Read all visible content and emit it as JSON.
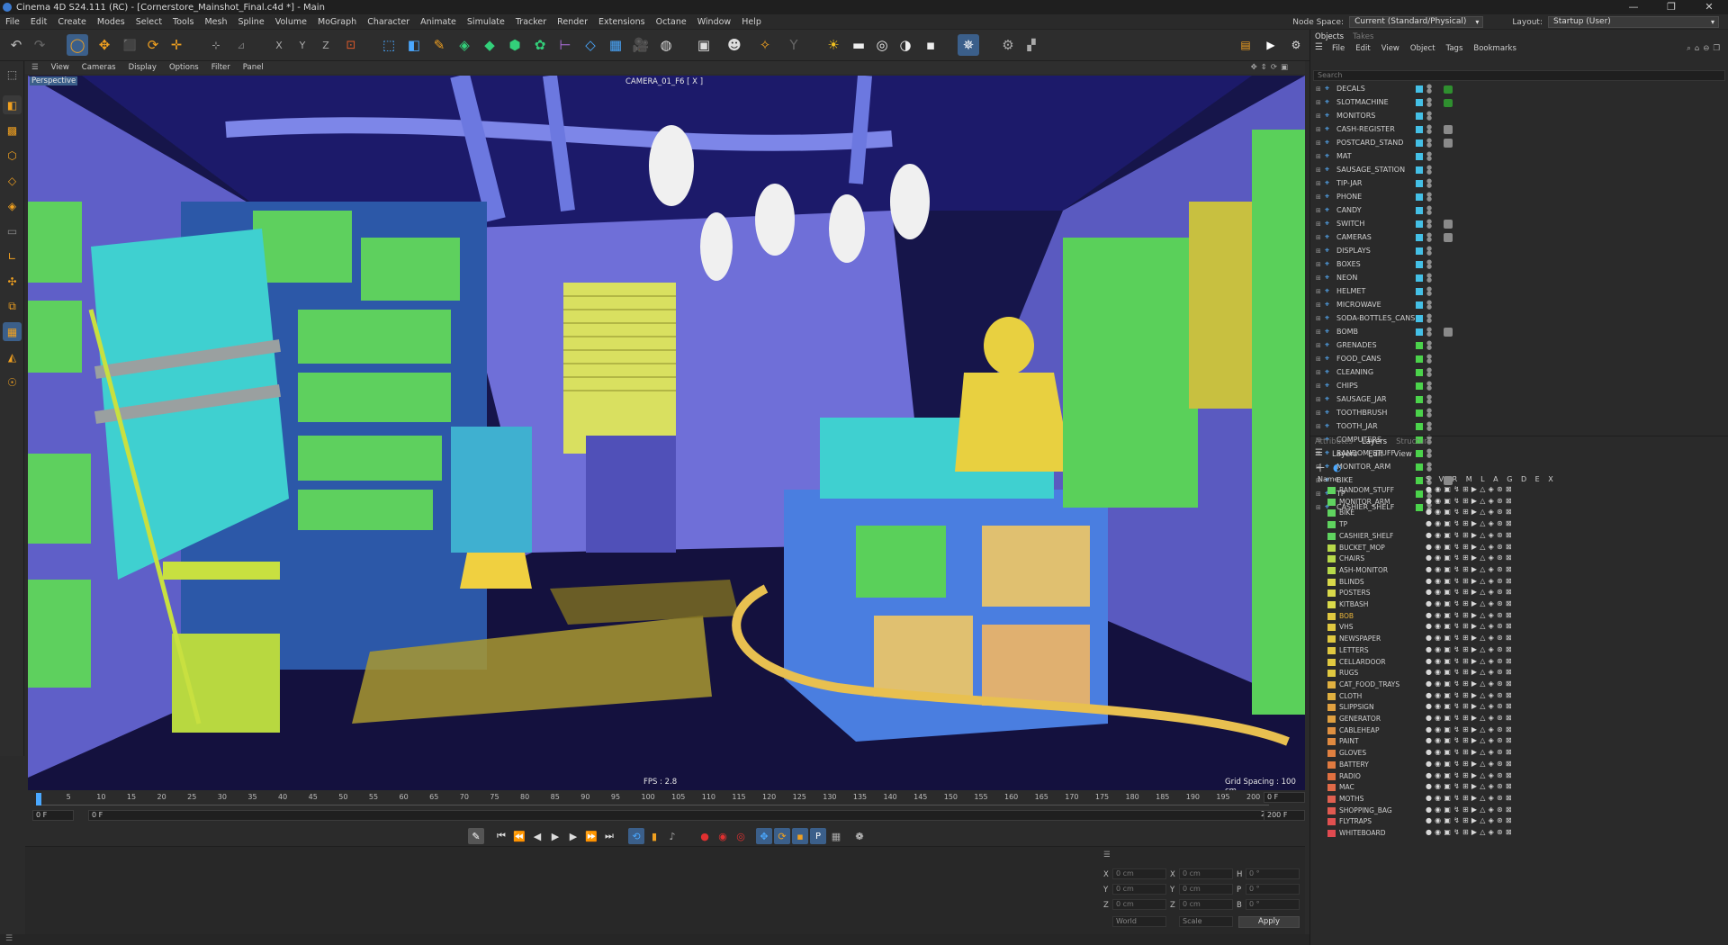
{
  "titlebar": {
    "title": "Cinema 4D S24.111 (RC) - [Cornerstore_Mainshot_Final.c4d *] - Main",
    "controls": [
      "—",
      "❐",
      "✕"
    ]
  },
  "menubar": {
    "items": [
      "File",
      "Edit",
      "Create",
      "Modes",
      "Select",
      "Tools",
      "Mesh",
      "Spline",
      "Volume",
      "MoGraph",
      "Character",
      "Animate",
      "Simulate",
      "Tracker",
      "Render",
      "Extensions",
      "Octane",
      "Window",
      "Help"
    ],
    "node_space_label": "Node Space:",
    "node_space_value": "Current (Standard/Physical)",
    "layout_label": "Layout:",
    "layout_value": "Startup (User)"
  },
  "viewport": {
    "menu": [
      "View",
      "Cameras",
      "Display",
      "Options",
      "Filter",
      "Panel"
    ],
    "view_name": "Perspective",
    "camera_label": "CAMERA_01_F6 [ X ]",
    "fps": "FPS : 2.8",
    "grid_spacing": "Grid Spacing : 100 cm"
  },
  "timeline": {
    "ticks": [
      "0",
      "5",
      "10",
      "15",
      "20",
      "25",
      "30",
      "35",
      "40",
      "45",
      "50",
      "55",
      "60",
      "65",
      "70",
      "75",
      "80",
      "85",
      "90",
      "95",
      "100",
      "105",
      "110",
      "115",
      "120",
      "125",
      "130",
      "135",
      "140",
      "145",
      "150",
      "155",
      "160",
      "165",
      "170",
      "175",
      "180",
      "185",
      "190",
      "195",
      "200"
    ],
    "current_frame": "0 F",
    "start_frame": "0 F",
    "preview_start": "0 F",
    "preview_end": "200 F",
    "end_frame": "200 F"
  },
  "coords": {
    "x_pos": "0 cm",
    "y_pos": "0 cm",
    "z_pos": "0 cm",
    "x_size": "0 cm",
    "y_size": "0 cm",
    "z_size": "0 cm",
    "h_rot": "0 °",
    "p_rot": "0 °",
    "b_rot": "0 °",
    "mode1": "World",
    "mode2": "Scale",
    "apply": "Apply",
    "labels": {
      "x": "X",
      "y": "Y",
      "z": "Z",
      "h": "H",
      "p": "P",
      "b": "B"
    }
  },
  "objects_panel": {
    "tabs": [
      "Objects",
      "Takes"
    ],
    "menu": [
      "File",
      "Edit",
      "View",
      "Object",
      "Tags",
      "Bookmarks"
    ],
    "search_placeholder": "Search",
    "rows": [
      {
        "name": "DECALS",
        "layer": "#44c0e6",
        "tag": "green"
      },
      {
        "name": "SLOTMACHINE",
        "layer": "#44c0e6",
        "tag": "green"
      },
      {
        "name": "MONITORS",
        "layer": "#44c0e6",
        "tag": ""
      },
      {
        "name": "CASH-REGISTER",
        "layer": "#44c0e6",
        "tag": "grey"
      },
      {
        "name": "POSTCARD_STAND",
        "layer": "#44c0e6",
        "tag": "grey"
      },
      {
        "name": "MAT",
        "layer": "#44c0e6",
        "tag": ""
      },
      {
        "name": "SAUSAGE_STATION",
        "layer": "#44c0e6",
        "tag": ""
      },
      {
        "name": "TIP-JAR",
        "layer": "#44c0e6",
        "tag": ""
      },
      {
        "name": "PHONE",
        "layer": "#44c0e6",
        "tag": ""
      },
      {
        "name": "CANDY",
        "layer": "#44c0e6",
        "tag": ""
      },
      {
        "name": "SWITCH",
        "layer": "#44c0e6",
        "tag": "grey"
      },
      {
        "name": "CAMERAS",
        "layer": "#44c0e6",
        "tag": "grey"
      },
      {
        "name": "DISPLAYS",
        "layer": "#44c0e6",
        "tag": ""
      },
      {
        "name": "BOXES",
        "layer": "#44c0e6",
        "tag": ""
      },
      {
        "name": "NEON",
        "layer": "#44c0e6",
        "tag": ""
      },
      {
        "name": "HELMET",
        "layer": "#44c0e6",
        "tag": ""
      },
      {
        "name": "MICROWAVE",
        "layer": "#44c0e6",
        "tag": ""
      },
      {
        "name": "SODA-BOTTLES_CANS",
        "layer": "#44c0e6",
        "tag": ""
      },
      {
        "name": "BOMB",
        "layer": "#44c0e6",
        "tag": "grey"
      },
      {
        "name": "GRENADES",
        "layer": "#4bd34b",
        "tag": ""
      },
      {
        "name": "FOOD_CANS",
        "layer": "#4bd34b",
        "tag": ""
      },
      {
        "name": "CLEANING",
        "layer": "#4bd34b",
        "tag": ""
      },
      {
        "name": "CHIPS",
        "layer": "#4bd34b",
        "tag": ""
      },
      {
        "name": "SAUSAGE_JAR",
        "layer": "#4bd34b",
        "tag": ""
      },
      {
        "name": "TOOTHBRUSH",
        "layer": "#4bd34b",
        "tag": ""
      },
      {
        "name": "TOOTH_JAR",
        "layer": "#4bd34b",
        "tag": ""
      },
      {
        "name": "COMPUTERS",
        "layer": "#4bd34b",
        "tag": ""
      },
      {
        "name": "RANDOM_STUFF",
        "layer": "#4bd34b",
        "tag": ""
      },
      {
        "name": "MONITOR_ARM",
        "layer": "#4bd34b",
        "tag": ""
      },
      {
        "name": "BIKE",
        "layer": "#4bd34b",
        "tag": "grey"
      },
      {
        "name": "TP",
        "layer": "#4bd34b",
        "tag": ""
      },
      {
        "name": "CASHIER_SHELF",
        "layer": "#4bd34b",
        "tag": ""
      }
    ]
  },
  "layers_panel": {
    "tabs": [
      "Attributes",
      "Layers",
      "Structure"
    ],
    "menu": [
      "Layers",
      "Edit",
      "View"
    ],
    "columns": "S V R M L A G D E X",
    "flags": "●◉▣↯⊞▶△◈⊛⊠",
    "rows": [
      {
        "name": "RANDOM_STUFF",
        "color": "#5fd35f",
        "label_color": "#cfcfcf"
      },
      {
        "name": "MONITOR_ARM",
        "color": "#5fd35f",
        "label_color": "#cfcfcf"
      },
      {
        "name": "BIKE",
        "color": "#5fd35f",
        "label_color": "#cfcfcf"
      },
      {
        "name": "TP",
        "color": "#5fd35f",
        "label_color": "#cfcfcf"
      },
      {
        "name": "CASHIER_SHELF",
        "color": "#5fd35f",
        "label_color": "#cfcfcf"
      },
      {
        "name": "BUCKET_MOP",
        "color": "#b7d94a",
        "label_color": "#cfcfcf"
      },
      {
        "name": "CHAIRS",
        "color": "#b7d94a",
        "label_color": "#cfcfcf"
      },
      {
        "name": "ASH-MONITOR",
        "color": "#b7d94a",
        "label_color": "#cfcfcf"
      },
      {
        "name": "BLINDS",
        "color": "#d9d94a",
        "label_color": "#cfcfcf"
      },
      {
        "name": "POSTERS",
        "color": "#d9d94a",
        "label_color": "#cfcfcf"
      },
      {
        "name": "KITBASH",
        "color": "#d9d94a",
        "label_color": "#cfcfcf"
      },
      {
        "name": "BOB",
        "color": "#e0c840",
        "label_color": "#e8b43a"
      },
      {
        "name": "VHS",
        "color": "#e0c840",
        "label_color": "#cfcfcf"
      },
      {
        "name": "NEWSPAPER",
        "color": "#e0c840",
        "label_color": "#cfcfcf"
      },
      {
        "name": "LETTERS",
        "color": "#e0c840",
        "label_color": "#cfcfcf"
      },
      {
        "name": "CELLARDOOR",
        "color": "#e0c840",
        "label_color": "#cfcfcf"
      },
      {
        "name": "RUGS",
        "color": "#e0c840",
        "label_color": "#cfcfcf"
      },
      {
        "name": "CAT_FOOD_TRAYS",
        "color": "#e0b040",
        "label_color": "#cfcfcf"
      },
      {
        "name": "CLOTH",
        "color": "#e0b040",
        "label_color": "#cfcfcf"
      },
      {
        "name": "SLIPPSIGN",
        "color": "#e0a040",
        "label_color": "#cfcfcf"
      },
      {
        "name": "GENERATOR",
        "color": "#e0a040",
        "label_color": "#cfcfcf"
      },
      {
        "name": "CABLEHEAP",
        "color": "#e09040",
        "label_color": "#cfcfcf"
      },
      {
        "name": "PAINT",
        "color": "#e08a40",
        "label_color": "#cfcfcf"
      },
      {
        "name": "GLOVES",
        "color": "#e08040",
        "label_color": "#cfcfcf"
      },
      {
        "name": "BATTERY",
        "color": "#e07a40",
        "label_color": "#cfcfcf"
      },
      {
        "name": "RADIO",
        "color": "#e07040",
        "label_color": "#cfcfcf"
      },
      {
        "name": "MAC",
        "color": "#e06a48",
        "label_color": "#cfcfcf"
      },
      {
        "name": "MOTHS",
        "color": "#e06050",
        "label_color": "#cfcfcf"
      },
      {
        "name": "SHOPPING_BAG",
        "color": "#e05a50",
        "label_color": "#cfcfcf"
      },
      {
        "name": "FLYTRAPS",
        "color": "#e05050",
        "label_color": "#cfcfcf"
      },
      {
        "name": "WHITEBOARD",
        "color": "#e04a50",
        "label_color": "#cfcfcf"
      }
    ]
  },
  "colors": {
    "accent": "#3b5f8a",
    "viewport_bg": "#16154a",
    "wall": "#6f6fd8",
    "cyan": "#3fd0d0",
    "green": "#5ad05a",
    "yellow": "#e0d040"
  },
  "icons": {
    "undo": "↶",
    "redo": "↷",
    "live_select": "◯",
    "move": "✥",
    "scale": "⬛",
    "rotate": "⟳",
    "recent": "✛",
    "cube": "◧",
    "pen": "✎",
    "subdiv": "◆",
    "clone": "⬢",
    "light": "☀",
    "camera": "🎥",
    "render": "▶",
    "settings": "⚙",
    "first": "⏮",
    "prev_key": "⏪",
    "prev": "◀",
    "play": "▶",
    "next": "▶",
    "next_key": "⏩",
    "last": "⏭",
    "loop": "⟲",
    "record": "●",
    "autokey": "◉"
  }
}
